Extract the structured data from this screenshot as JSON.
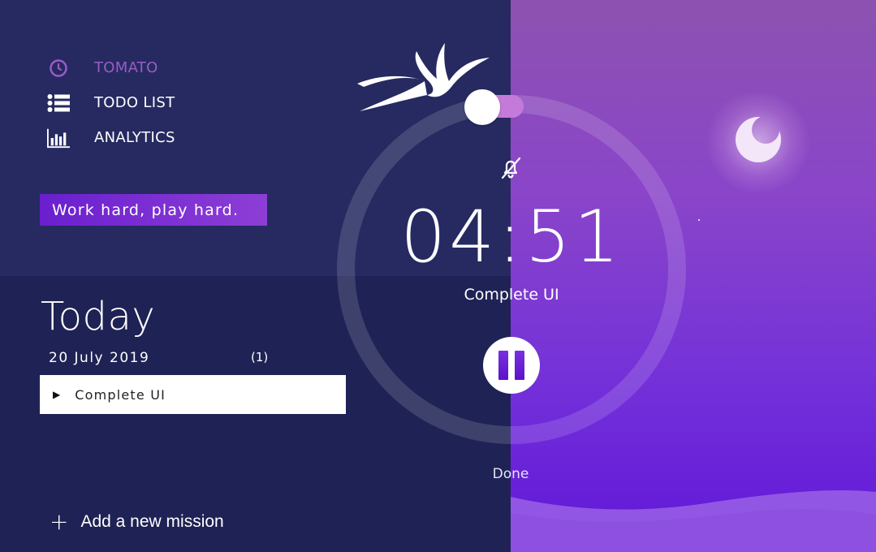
{
  "nav": {
    "items": [
      {
        "label": "TOMATO",
        "icon": "clock-icon",
        "active": true
      },
      {
        "label": "TODO LIST",
        "icon": "list-icon",
        "active": false
      },
      {
        "label": "ANALYTICS",
        "icon": "bar-chart-icon",
        "active": false
      }
    ]
  },
  "motto": "Work hard, play hard.",
  "today": {
    "title": "Today",
    "date": "20 July 2019",
    "count": "(1)",
    "tasks": [
      {
        "name": "Complete UI",
        "icon": "play-icon"
      }
    ]
  },
  "add_mission": {
    "label": "Add a new mission",
    "icon": "plus-icon"
  },
  "timer": {
    "time": "04:51",
    "task": "Complete UI",
    "done_label": "Done",
    "mute_icon": "bell-off-icon",
    "pause_icon": "pause-icon",
    "theme_toggle": "on"
  },
  "colors": {
    "left_top": "#262a61",
    "left_bottom": "#1f2254",
    "accent_purple": "#6a1fcf",
    "active_nav": "#9a5bc8",
    "moon": "#f3e6f8"
  }
}
